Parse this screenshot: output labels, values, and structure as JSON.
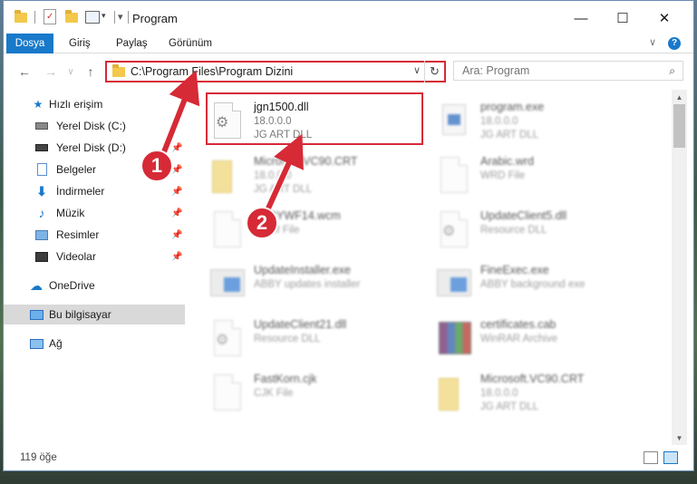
{
  "window": {
    "title": "Program",
    "controls": {
      "minimize": "—",
      "maximize": "☐",
      "close": "✕"
    }
  },
  "ribbon": {
    "tabs": [
      "Dosya",
      "Giriş",
      "Paylaş",
      "Görünüm"
    ],
    "active_tab": "Dosya",
    "expand_icon": "chevron-down-icon",
    "help_icon": "?"
  },
  "navigation": {
    "back": "←",
    "forward": "→",
    "recent": "∨",
    "up": "↑",
    "address_path": "C:\\Program Files\\Program Dizini",
    "address_dropdown": "∨",
    "refresh": "↻",
    "search_placeholder": "Ara: Program"
  },
  "sidebar": {
    "items": [
      {
        "label": "Hızlı erişim",
        "icon": "star-icon",
        "pinned": false
      },
      {
        "label": "Yerel Disk (C:)",
        "icon": "drive-icon",
        "pinned": false
      },
      {
        "label": "Yerel Disk (D:)",
        "icon": "drive-icon",
        "pinned": true
      },
      {
        "label": "Belgeler",
        "icon": "documents-icon",
        "pinned": true
      },
      {
        "label": "İndirmeler",
        "icon": "download-icon",
        "pinned": true
      },
      {
        "label": "Müzik",
        "icon": "music-icon",
        "pinned": true
      },
      {
        "label": "Resimler",
        "icon": "pictures-icon",
        "pinned": true
      },
      {
        "label": "Videolar",
        "icon": "videos-icon",
        "pinned": true
      },
      {
        "label": "OneDrive",
        "icon": "cloud-icon",
        "pinned": false
      },
      {
        "label": "Bu bilgisayar",
        "icon": "computer-icon",
        "pinned": false,
        "selected": true
      },
      {
        "label": "Ağ",
        "icon": "network-icon",
        "pinned": false
      }
    ]
  },
  "files": {
    "highlighted": {
      "name": "jgn1500.dll",
      "version": "18.0.0.0",
      "description": "JG ART DLL"
    },
    "others": [
      {
        "name": "program.exe",
        "sub1": "18.0.0.0",
        "sub2": "JG ART DLL"
      },
      {
        "name": "Microsoft.VC90.CRT",
        "sub1": "18.0.0.0",
        "sub2": "JG ART DLL"
      },
      {
        "name": "Arabic.wrd",
        "sub1": "WRD File",
        "sub2": ""
      },
      {
        "name": "ABBYWF14.wcm",
        "sub1": "WCM File",
        "sub2": ""
      },
      {
        "name": "UpdateClient5.dll",
        "sub1": "Resource DLL",
        "sub2": ""
      },
      {
        "name": "UpdateInstaller.exe",
        "sub1": "ABBY updates installer",
        "sub2": ""
      },
      {
        "name": "FineExec.exe",
        "sub1": "ABBY background exe",
        "sub2": ""
      },
      {
        "name": "UpdateClient21.dll",
        "sub1": "Resource DLL",
        "sub2": ""
      },
      {
        "name": "certificates.cab",
        "sub1": "WinRAR Archive",
        "sub2": ""
      },
      {
        "name": "FastKorn.cjk",
        "sub1": "CJK File",
        "sub2": ""
      },
      {
        "name": "Microsoft.VC90.CRT",
        "sub1": "18.0.0.0",
        "sub2": "JG ART DLL"
      }
    ]
  },
  "status": {
    "item_count": "119 öğe"
  },
  "callouts": {
    "one": "1",
    "two": "2"
  },
  "colors": {
    "accent": "#1979ca",
    "highlight_red": "#d62a36",
    "folder": "#f3c84b"
  }
}
